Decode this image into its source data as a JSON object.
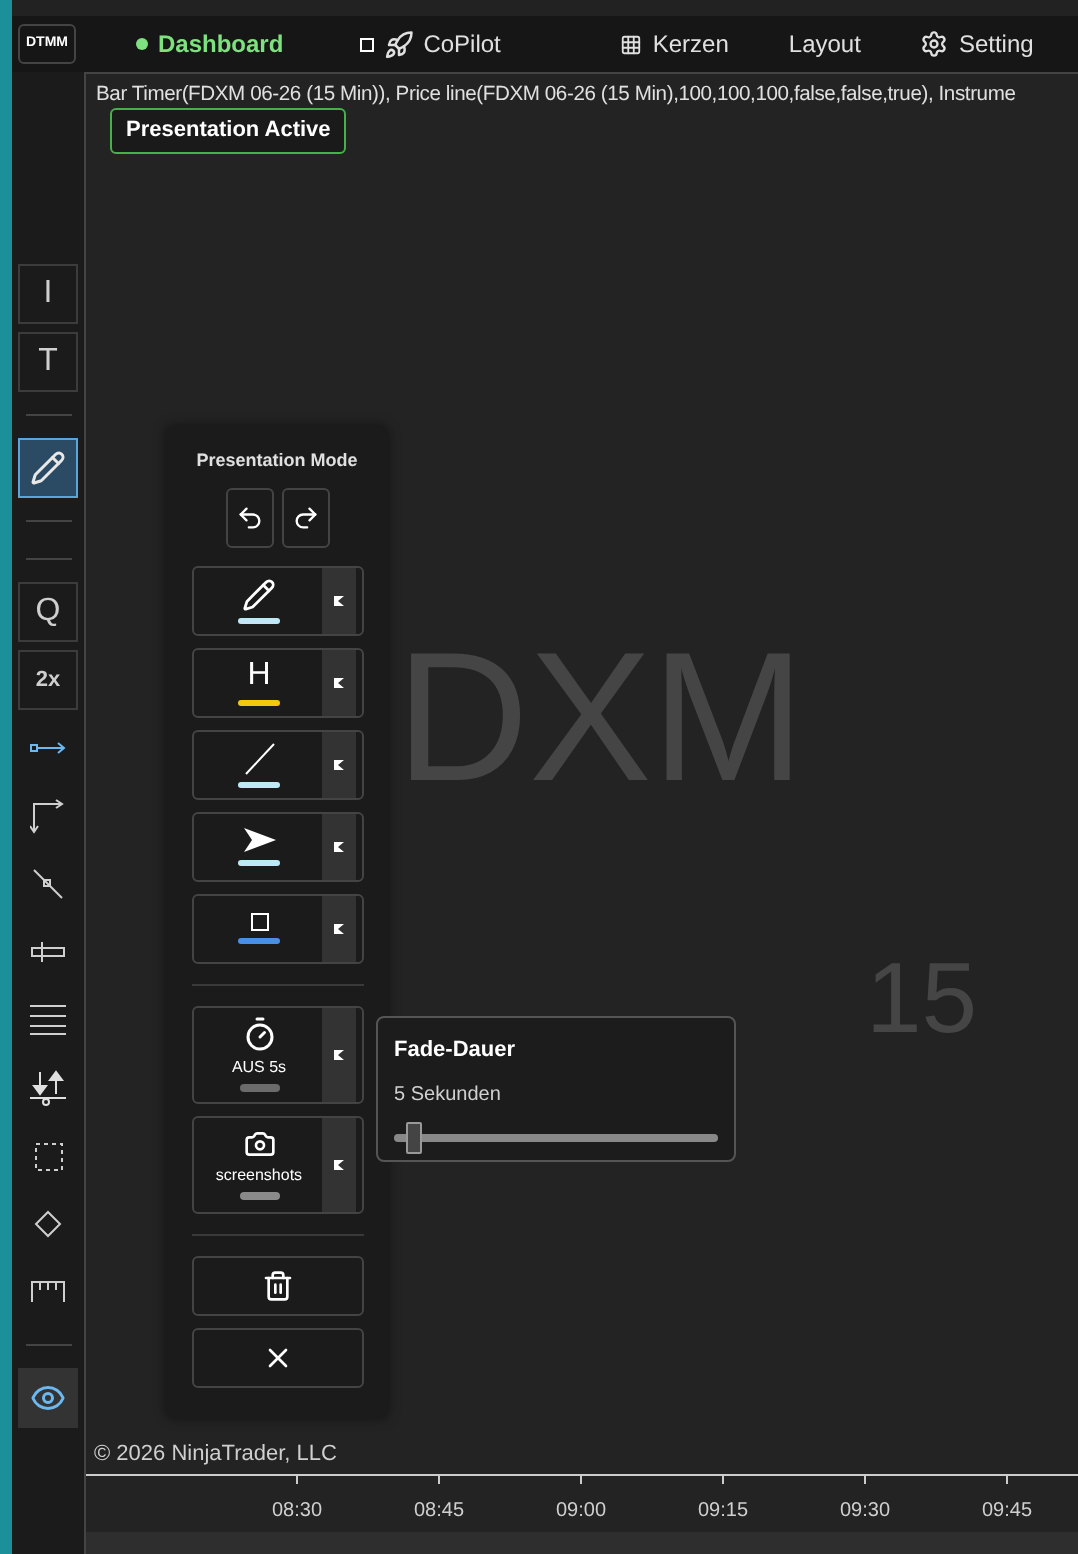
{
  "logo": "DTMM",
  "nav": [
    {
      "label": "Dashboard",
      "selected": true,
      "kind": "dot"
    },
    {
      "label": "CoPilot",
      "selected": false,
      "kind": "rocket"
    },
    {
      "label": "Kerzen",
      "selected": false,
      "kind": "grid"
    },
    {
      "label": "Layout",
      "selected": false,
      "kind": "plain"
    },
    {
      "label": "Setting",
      "selected": false,
      "kind": "gear"
    }
  ],
  "indicators": "Bar Timer(FDXM 06-26 (15 Min)), Price line(FDXM 06-26 (15 Min),100,100,100,false,false,true), Instrume",
  "presentation_badge": "Presentation Active",
  "tools": [
    {
      "kind": "text",
      "label": "I",
      "selected": false
    },
    {
      "kind": "text",
      "label": "T",
      "selected": false
    },
    {
      "kind": "divider"
    },
    {
      "kind": "pencil",
      "selected": true
    },
    {
      "kind": "divider"
    },
    {
      "kind": "divider"
    },
    {
      "kind": "text",
      "label": "Q",
      "selected": false
    },
    {
      "kind": "small",
      "label": "2x",
      "selected": false
    },
    {
      "kind": "ray",
      "selected": false
    },
    {
      "kind": "corner",
      "selected": false
    },
    {
      "kind": "diagonal",
      "selected": false
    },
    {
      "kind": "handle",
      "selected": false
    },
    {
      "kind": "lines",
      "selected": false
    },
    {
      "kind": "updown",
      "selected": false
    },
    {
      "kind": "dashrect",
      "selected": false
    },
    {
      "kind": "diamond",
      "selected": false
    },
    {
      "kind": "ruler",
      "selected": false
    },
    {
      "kind": "divider"
    },
    {
      "kind": "eye",
      "selected": true
    }
  ],
  "panel": {
    "title": "Presentation Mode",
    "draw_tools": [
      {
        "kind": "pencil",
        "color": "#bfe8f7"
      },
      {
        "kind": "letter",
        "label": "H",
        "color": "#f2c80f"
      },
      {
        "kind": "line",
        "color": "#bfe8f7"
      },
      {
        "kind": "arrow",
        "color": "#bfe8f7"
      },
      {
        "kind": "rect",
        "color": "#4a8fe7"
      }
    ],
    "options": [
      {
        "kind": "timer",
        "label": "AUS 5s",
        "color": "#6b6b6b"
      },
      {
        "kind": "camera",
        "label": "screenshots",
        "color": "#8a8a8a"
      }
    ]
  },
  "fade_popup": {
    "title": "Fade-Dauer",
    "value": "5 Sekunden",
    "level": 0.04
  },
  "watermark": {
    "symbol": "DXM",
    "period": "15"
  },
  "copyright": "© 2026 NinjaTrader, LLC",
  "time_axis": [
    "08:30",
    "08:45",
    "09:00",
    "09:15",
    "09:30",
    "09:45"
  ]
}
